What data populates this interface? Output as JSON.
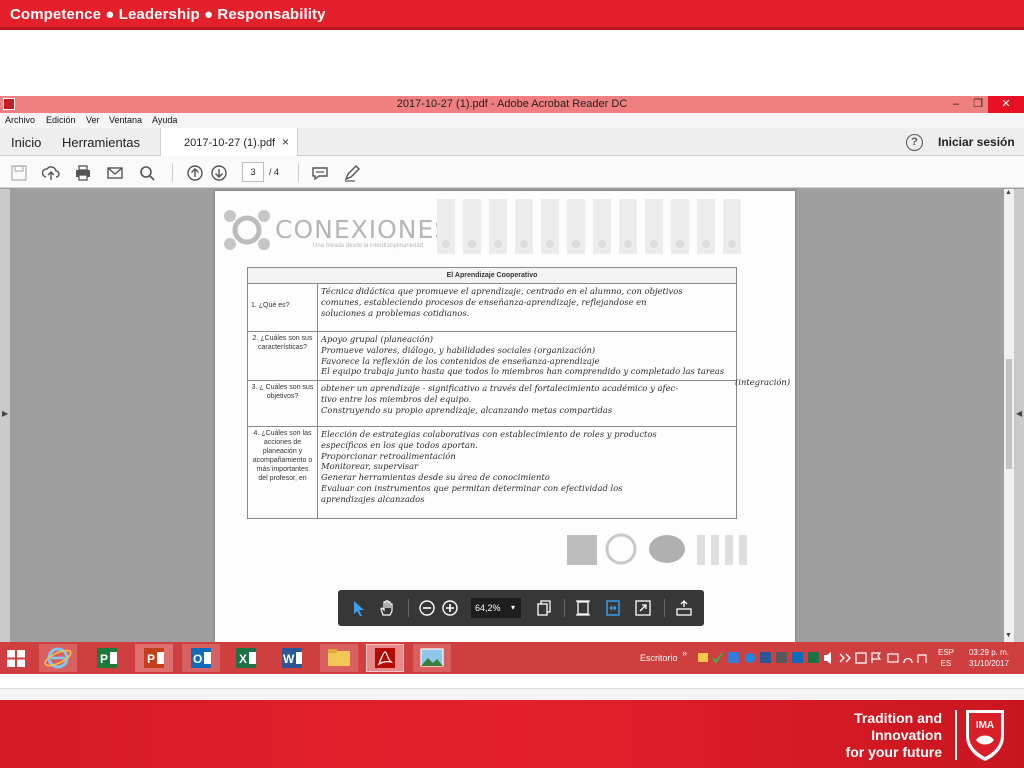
{
  "slide": {
    "motto": "Competence ● Leadership ● Responsability",
    "tagline": [
      "Tradition and",
      "Innovation",
      "for your future"
    ],
    "crest_text": "IMA"
  },
  "window": {
    "title": "2017-10-27 (1).pdf - Adobe Acrobat Reader DC",
    "controls": {
      "minimize": "–",
      "maximize": "❐",
      "close": "✕"
    },
    "menu": [
      "Archivo",
      "Edición",
      "Ver",
      "Ventana",
      "Ayuda"
    ],
    "tabs": {
      "home": "Inicio",
      "tools": "Herramientas",
      "document": "2017-10-27 (1).pdf",
      "close": "×"
    },
    "help": "?",
    "signin": "Iniciar sesión",
    "page_current": "3",
    "page_total": "/ 4",
    "nav_arrows": {
      "left": "◀",
      "right": "▶",
      "up": "▲",
      "down": "▼"
    },
    "icons": {
      "toolbar": [
        "save-icon",
        "upload-icon",
        "print-icon",
        "mail-icon",
        "search-icon",
        "page-up-icon",
        "page-down-icon",
        "comment-icon",
        "pen-icon"
      ],
      "floating": [
        "select-arrow-icon",
        "hand-icon",
        "zoom-out-icon",
        "zoom-in-icon",
        "copy-icon",
        "fit-page-icon",
        "fit-width-icon",
        "fullscreen-icon",
        "read-mode-icon"
      ]
    }
  },
  "pdf": {
    "logo": "CONEXIONES",
    "logo_subtitle": "Una mirada desde la interdisciplinariedad",
    "table_title": "El Aprendizaje Cooperativo",
    "rows": [
      {
        "question": "1. ¿Qué es?",
        "answer": [
          "Técnica didáctica que promueve el aprendizaje, centrado en el alumno, con objetivos",
          "comunes, estableciendo procesos de enseñanza-aprendizaje, reflejandose en",
          "soluciones a problemas cotidianos."
        ]
      },
      {
        "question": "2. ¿Cuáles son sus características?",
        "answer": [
          "Apoyo grupal (planeación)",
          "Promueve valores, diálogo, y habilidades sociales (organización)",
          "Favorece la reflexión de los contenidos de enseñanza-aprendizaje",
          "El equipo trabaja junto hasta que todos lo miembros han comprendido y completado las tareas"
        ]
      },
      {
        "question": "3. ¿ Cuáles son sus objetivos?",
        "answer": [
          "obtener un aprendizaje - significativo a través del fortalecimiento académico y afec-",
          "tivo entre los miembros del equipo.",
          "Construyendo su propio aprendizaje, alcanzando metas compartidas"
        ]
      },
      {
        "question": "4. ¿Cuáles son las acciones de planeación y acompañamiento o más importantes del profesor, en",
        "answer": [
          "Elección de estrategias colaborativas con establecimiento de roles y productos",
          "específicos en los que todos aportan.",
          "Proporcionar retroalimentación",
          "Monitorear, supervisar",
          "Generar herramientas desde su área de conocimiento",
          "Evaluar con instrumentos que permitan determinar con efectividad los",
          "aprendizajes alcanzados"
        ]
      }
    ],
    "overflow_note": "(integración)"
  },
  "float_toolbar": {
    "zoom": "64,2%",
    "caret": "▾"
  },
  "taskbar": {
    "apps": [
      "Internet Explorer",
      "Project",
      "PowerPoint",
      "Outlook",
      "Excel",
      "Word",
      "Explorador de archivos",
      "Adobe Acrobat Reader DC",
      "Fotos"
    ],
    "desktop_label": "Escritorio",
    "chevron": "»",
    "lang": [
      "ESP",
      "ES"
    ],
    "time": "03:29 p. m.",
    "date": "31/10/2017"
  },
  "colors": {
    "banner_red": "#e4212b",
    "titlebar_pink": "#f08080",
    "taskbar_red": "#cf3f40"
  }
}
